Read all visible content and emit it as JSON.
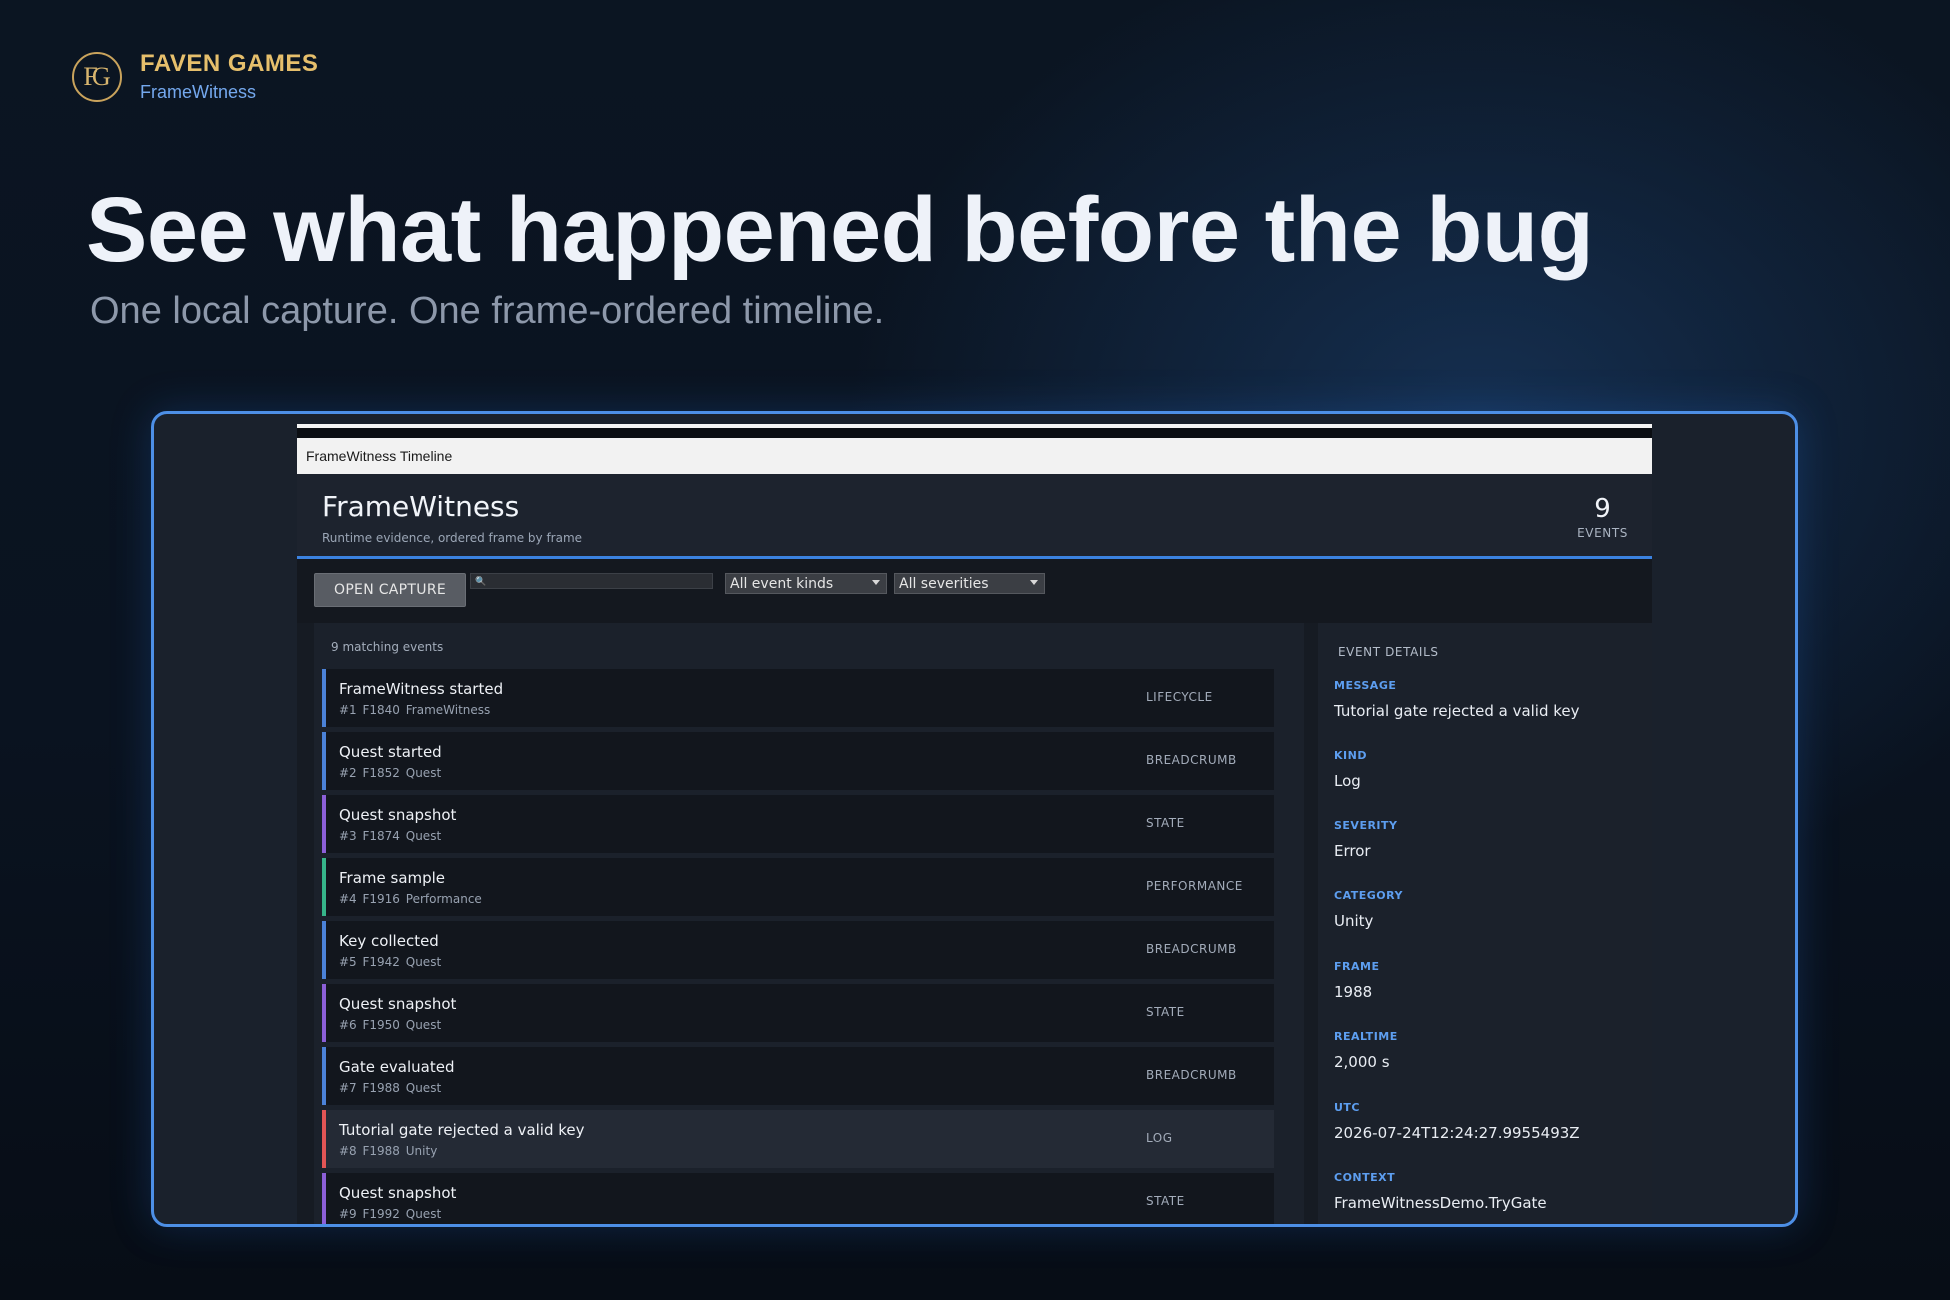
{
  "brand": {
    "logo_text": "FG",
    "name": "FAVEN GAMES",
    "product": "FrameWitness"
  },
  "hero": {
    "title": "See what happened before the bug",
    "subtitle": "One local capture. One frame-ordered timeline."
  },
  "window": {
    "title": "FrameWitness Timeline"
  },
  "app": {
    "title": "FrameWitness",
    "tagline": "Runtime evidence, ordered frame by frame",
    "events_count": "9",
    "events_label": "EVENTS"
  },
  "toolbar": {
    "open_label": "OPEN CAPTURE",
    "search_value": "",
    "kinds_selected": "All event kinds",
    "severities_selected": "All severities"
  },
  "list": {
    "meta": "9 matching events",
    "events": [
      {
        "title": "FrameWitness started",
        "sub": "#1  F1840  FrameWitness",
        "kind": "LIFECYCLE",
        "color": "#4b82d8"
      },
      {
        "title": "Quest started",
        "sub": "#2  F1852  Quest",
        "kind": "BREADCRUMB",
        "color": "#4b82d8"
      },
      {
        "title": "Quest snapshot",
        "sub": "#3  F1874  Quest",
        "kind": "STATE",
        "color": "#8c5fd8"
      },
      {
        "title": "Frame sample",
        "sub": "#4  F1916  Performance",
        "kind": "PERFORMANCE",
        "color": "#36b58a"
      },
      {
        "title": "Key collected",
        "sub": "#5  F1942  Quest",
        "kind": "BREADCRUMB",
        "color": "#4b82d8"
      },
      {
        "title": "Quest snapshot",
        "sub": "#6  F1950  Quest",
        "kind": "STATE",
        "color": "#8c5fd8"
      },
      {
        "title": "Gate evaluated",
        "sub": "#7  F1988  Quest",
        "kind": "BREADCRUMB",
        "color": "#4b82d8"
      },
      {
        "title": "Tutorial gate rejected a valid key",
        "sub": "#8  F1988  Unity",
        "kind": "LOG",
        "color": "#e25555",
        "selected": true
      },
      {
        "title": "Quest snapshot",
        "sub": "#9  F1992  Quest",
        "kind": "STATE",
        "color": "#8c5fd8"
      }
    ]
  },
  "details": {
    "heading": "EVENT DETAILS",
    "fields": [
      {
        "label": "MESSAGE",
        "value": "Tutorial gate rejected a valid key"
      },
      {
        "label": "KIND",
        "value": "Log"
      },
      {
        "label": "SEVERITY",
        "value": "Error"
      },
      {
        "label": "CATEGORY",
        "value": "Unity"
      },
      {
        "label": "FRAME",
        "value": "1988"
      },
      {
        "label": "REALTIME",
        "value": "2,000 s"
      },
      {
        "label": "UTC",
        "value": "2026-07-24T12:24:27.9955493Z"
      },
      {
        "label": "CONTEXT",
        "value": "FrameWitnessDemo.TryGate"
      }
    ]
  }
}
